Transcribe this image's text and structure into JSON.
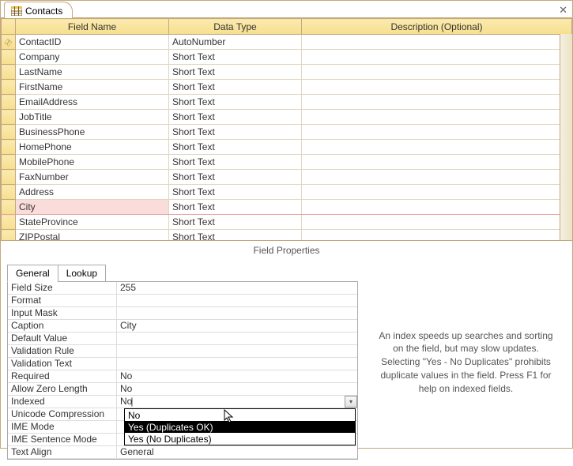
{
  "tab": {
    "title": "Contacts"
  },
  "grid": {
    "headers": {
      "field": "Field Name",
      "type": "Data Type",
      "desc": "Description (Optional)"
    },
    "rows": [
      {
        "key": true,
        "name": "ContactID",
        "type": "AutoNumber",
        "selected": false
      },
      {
        "key": false,
        "name": "Company",
        "type": "Short Text",
        "selected": false
      },
      {
        "key": false,
        "name": "LastName",
        "type": "Short Text",
        "selected": false
      },
      {
        "key": false,
        "name": "FirstName",
        "type": "Short Text",
        "selected": false
      },
      {
        "key": false,
        "name": "EmailAddress",
        "type": "Short Text",
        "selected": false
      },
      {
        "key": false,
        "name": "JobTitle",
        "type": "Short Text",
        "selected": false
      },
      {
        "key": false,
        "name": "BusinessPhone",
        "type": "Short Text",
        "selected": false
      },
      {
        "key": false,
        "name": "HomePhone",
        "type": "Short Text",
        "selected": false
      },
      {
        "key": false,
        "name": "MobilePhone",
        "type": "Short Text",
        "selected": false
      },
      {
        "key": false,
        "name": "FaxNumber",
        "type": "Short Text",
        "selected": false
      },
      {
        "key": false,
        "name": "Address",
        "type": "Short Text",
        "selected": false
      },
      {
        "key": false,
        "name": "City",
        "type": "Short Text",
        "selected": true
      },
      {
        "key": false,
        "name": "StateProvince",
        "type": "Short Text",
        "selected": false
      },
      {
        "key": false,
        "name": "ZIPPostal",
        "type": "Short Text",
        "selected": false
      }
    ]
  },
  "props_title": "Field Properties",
  "tabs": {
    "general": "General",
    "lookup": "Lookup"
  },
  "props": [
    {
      "label": "Field Size",
      "value": "255"
    },
    {
      "label": "Format",
      "value": ""
    },
    {
      "label": "Input Mask",
      "value": ""
    },
    {
      "label": "Caption",
      "value": "City"
    },
    {
      "label": "Default Value",
      "value": ""
    },
    {
      "label": "Validation Rule",
      "value": ""
    },
    {
      "label": "Validation Text",
      "value": ""
    },
    {
      "label": "Required",
      "value": "No"
    },
    {
      "label": "Allow Zero Length",
      "value": "No"
    },
    {
      "label": "Indexed",
      "value": "No",
      "focus": true
    },
    {
      "label": "Unicode Compression",
      "value": ""
    },
    {
      "label": "IME Mode",
      "value": ""
    },
    {
      "label": "IME Sentence Mode",
      "value": ""
    },
    {
      "label": "Text Align",
      "value": "General"
    }
  ],
  "dropdown": {
    "opt0": "No",
    "opt1": "Yes (Duplicates OK)",
    "opt2": "Yes (No Duplicates)"
  },
  "help": "An index speeds up searches and sorting on the field, but may slow updates. Selecting \"Yes - No Duplicates\" prohibits duplicate values in the field. Press F1 for help on indexed fields."
}
